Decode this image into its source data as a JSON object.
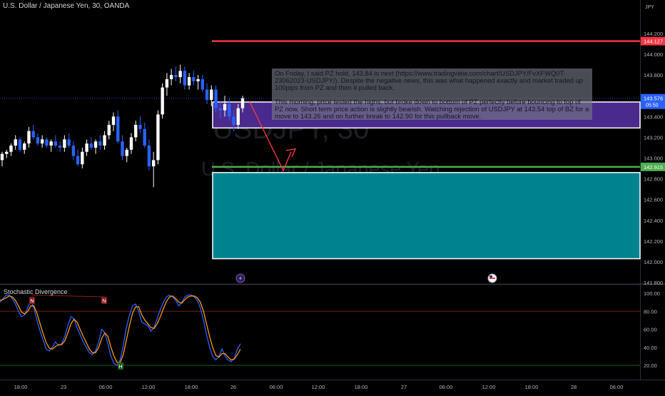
{
  "header": {
    "title": "U.S. Dollar / Japanese Yen, 30, OANDA"
  },
  "watermark": {
    "symbol": "USDJPY, 30",
    "name": "U.S. Dollar / Japanese Yen"
  },
  "price_axis": {
    "currency": "JPY",
    "last_price": "143.576",
    "countdown": "05:50",
    "resistance_label": "144.127",
    "support_label": "142.915"
  },
  "note": {
    "paragraph_1": "On Friday, I said PZ hold, 143.84 is next (https://www.tradingview.com/chart/USDJPY/FvXFWQ0T-23062023-USDJPY/). Despite the negative news, this was what happened exactly and market traded up 100pips from PZ and then it pulled back.",
    "paragraph_2": "This morning, price tested the highs, but broke down to bottom of PZ perfectly before bouncing to top of PZ now. Short term price action is slightly bearish. Watching rejection of USDJPY at 143.54 top of BZ for a move to 143.26 and on further break to 142.90 for this pullback move."
  },
  "indicator": {
    "title": "Stochastic Divergence",
    "bear_marker": "N",
    "bull_marker": "H"
  },
  "icons": {
    "event_1": "lightning-icon",
    "event_2": "us-flag-icon"
  },
  "colors": {
    "background": "#000000",
    "bull_candle": "#ffffff",
    "bear_candle": "#2962ff",
    "resistance": "#f23645",
    "support": "#4caf50",
    "zone_top": "#4a2a8c",
    "zone_bottom": "#00838f",
    "stoch_k": "#2962ff",
    "stoch_d": "#ff9800"
  },
  "chart_data": [
    {
      "type": "candlestick",
      "title": "U.S. Dollar / Japanese Yen, 30, OANDA",
      "ylim": [
        141.8,
        144.3
      ],
      "y_ticks": [
        "144.200",
        "144.000",
        "143.800",
        "143.600",
        "143.400",
        "143.200",
        "143.000",
        "142.800",
        "142.600",
        "142.400",
        "142.200",
        "142.000",
        "141.800"
      ],
      "x_ticks": [
        "18:00",
        "23",
        "06:00",
        "12:00",
        "18:00",
        "26",
        "06:00",
        "12:00",
        "18:00",
        "27",
        "06:00",
        "12:00",
        "18:00",
        "28",
        "06:00"
      ],
      "candles": [
        [
          142.98,
          143.06,
          142.92,
          143.04
        ],
        [
          143.04,
          143.08,
          143.0,
          143.06
        ],
        [
          143.06,
          143.14,
          143.02,
          143.12
        ],
        [
          143.12,
          143.22,
          143.08,
          143.18
        ],
        [
          143.18,
          143.2,
          143.06,
          143.08
        ],
        [
          143.08,
          143.16,
          143.04,
          143.14
        ],
        [
          143.14,
          143.3,
          143.1,
          143.26
        ],
        [
          143.26,
          143.32,
          143.18,
          143.2
        ],
        [
          143.2,
          143.24,
          143.12,
          143.14
        ],
        [
          143.14,
          143.22,
          143.1,
          143.18
        ],
        [
          143.18,
          143.2,
          143.1,
          143.12
        ],
        [
          143.12,
          143.18,
          143.06,
          143.16
        ],
        [
          143.16,
          143.22,
          143.1,
          143.12
        ],
        [
          143.12,
          143.16,
          143.06,
          143.1
        ],
        [
          143.1,
          143.22,
          143.06,
          143.18
        ],
        [
          143.18,
          143.24,
          143.1,
          143.12
        ],
        [
          143.12,
          143.16,
          142.98,
          143.02
        ],
        [
          143.02,
          143.08,
          142.92,
          142.94
        ],
        [
          142.94,
          143.1,
          142.9,
          143.06
        ],
        [
          143.06,
          143.18,
          143.02,
          143.14
        ],
        [
          143.14,
          143.2,
          143.08,
          143.1
        ],
        [
          143.1,
          143.18,
          143.04,
          143.16
        ],
        [
          143.16,
          143.22,
          143.08,
          143.12
        ],
        [
          143.12,
          143.26,
          143.08,
          143.22
        ],
        [
          143.22,
          143.36,
          143.18,
          143.32
        ],
        [
          143.32,
          143.44,
          143.26,
          143.4
        ],
        [
          143.4,
          143.46,
          143.14,
          143.16
        ],
        [
          143.16,
          143.22,
          142.98,
          143.02
        ],
        [
          143.02,
          143.1,
          142.96,
          143.08
        ],
        [
          143.08,
          143.24,
          143.04,
          143.2
        ],
        [
          143.2,
          143.36,
          143.16,
          143.32
        ],
        [
          143.32,
          143.4,
          143.24,
          143.28
        ],
        [
          143.28,
          143.34,
          143.1,
          143.12
        ],
        [
          143.12,
          143.18,
          142.88,
          142.92
        ],
        [
          142.92,
          143.06,
          142.72,
          142.98
        ],
        [
          142.98,
          143.46,
          142.94,
          143.42
        ],
        [
          143.42,
          143.72,
          143.38,
          143.68
        ],
        [
          143.68,
          143.82,
          143.6,
          143.76
        ],
        [
          143.76,
          143.86,
          143.7,
          143.8
        ],
        [
          143.8,
          143.88,
          143.74,
          143.78
        ],
        [
          143.78,
          143.9,
          143.72,
          143.84
        ],
        [
          143.84,
          143.88,
          143.66,
          143.7
        ],
        [
          143.7,
          143.82,
          143.66,
          143.78
        ],
        [
          143.78,
          143.84,
          143.7,
          143.74
        ],
        [
          143.74,
          143.8,
          143.66,
          143.76
        ],
        [
          143.76,
          143.8,
          143.64,
          143.66
        ],
        [
          143.66,
          143.72,
          143.52,
          143.56
        ],
        [
          143.56,
          143.7,
          143.5,
          143.66
        ],
        [
          143.66,
          143.7,
          143.44,
          143.48
        ],
        [
          143.48,
          143.54,
          143.38,
          143.46
        ],
        [
          143.46,
          143.6,
          143.4,
          143.52
        ],
        [
          143.52,
          143.58,
          143.36,
          143.4
        ],
        [
          143.4,
          143.46,
          143.26,
          143.32
        ],
        [
          143.32,
          143.52,
          143.28,
          143.48
        ],
        [
          143.48,
          143.6,
          143.44,
          143.576
        ]
      ],
      "levels": [
        {
          "label": "144.127",
          "value": 144.127,
          "color": "#f23645"
        },
        {
          "label": "142.915",
          "value": 142.915,
          "color": "#4caf50"
        }
      ],
      "zones": [
        {
          "from": 143.29,
          "to": 143.54,
          "color": "#4a2a8c"
        },
        {
          "from": 142.03,
          "to": 142.86,
          "color": "#00838f"
        }
      ],
      "projection": [
        [
          143.54
        ],
        [
          142.88
        ],
        [
          143.06
        ]
      ]
    },
    {
      "type": "line",
      "title": "Stochastic Divergence",
      "ylim": [
        10,
        105
      ],
      "y_ticks": [
        "100.00",
        "80.00",
        "60.00",
        "40.00",
        "20.00"
      ],
      "bands": [
        80,
        20
      ],
      "series": [
        {
          "values": [
            90,
            94,
            98,
            98,
            94,
            88,
            80,
            74,
            76,
            84,
            92,
            84,
            70,
            58,
            48,
            38,
            36,
            40,
            46,
            42,
            44,
            52,
            64,
            74,
            72,
            62,
            54,
            46,
            40,
            34,
            32,
            36,
            46,
            60,
            56,
            44,
            30,
            22,
            20,
            26,
            42,
            62,
            76,
            86,
            88,
            80,
            68,
            66,
            64,
            58,
            62,
            72,
            82,
            90,
            96,
            98,
            96,
            92,
            86,
            90,
            96,
            98,
            98,
            96,
            92,
            84,
            70,
            54,
            40,
            30,
            26,
            30,
            38,
            30,
            26,
            24,
            28,
            38,
            44
          ]
        },
        {
          "values": [
            92,
            93,
            95,
            97,
            96,
            92,
            86,
            79,
            77,
            80,
            86,
            86,
            78,
            66,
            55,
            45,
            39,
            38,
            41,
            43,
            43,
            47,
            56,
            66,
            71,
            68,
            60,
            52,
            45,
            38,
            34,
            34,
            40,
            50,
            56,
            52,
            40,
            30,
            23,
            23,
            32,
            48,
            64,
            78,
            85,
            85,
            76,
            70,
            66,
            62,
            61,
            66,
            74,
            83,
            91,
            96,
            97,
            94,
            90,
            89,
            93,
            96,
            97,
            97,
            95,
            90,
            80,
            66,
            52,
            40,
            31,
            29,
            33,
            33,
            29,
            26,
            27,
            32,
            38
          ]
        }
      ],
      "markers": [
        {
          "label": "N",
          "kind": "bearish"
        },
        {
          "label": "N",
          "kind": "bearish"
        },
        {
          "label": "H",
          "kind": "bullish"
        }
      ]
    }
  ]
}
